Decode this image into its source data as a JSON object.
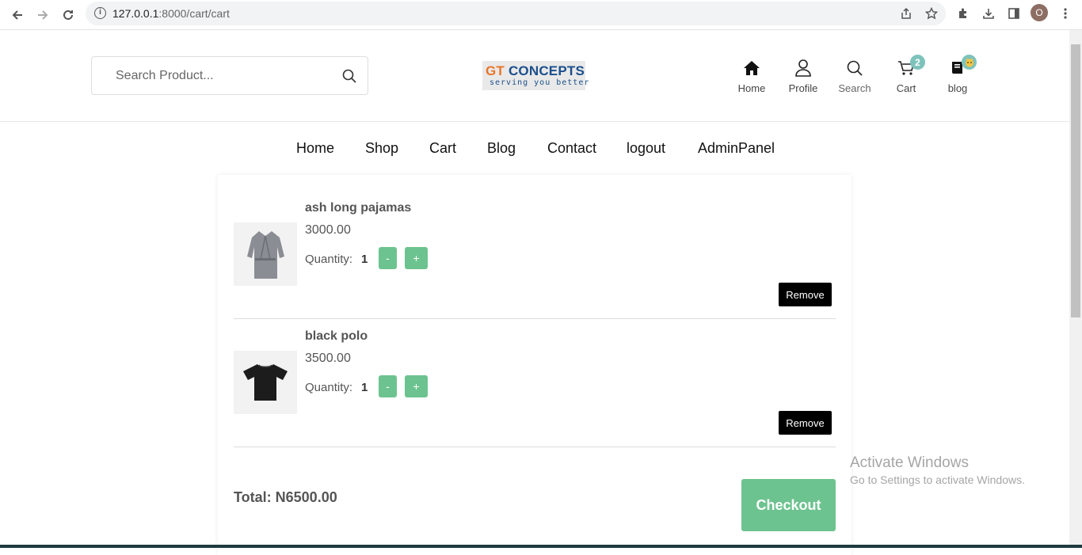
{
  "browser": {
    "url_host": "127.0.0.1",
    "url_port_path": ":8000/cart/cart",
    "profile_initial": "O"
  },
  "header": {
    "search_placeholder": "Search Product...",
    "logo": {
      "brand_gt": "GT",
      "brand_rest": " CONCEPTS",
      "tagline": "serving you better"
    },
    "icons": [
      {
        "label": "Home"
      },
      {
        "label": "Profile"
      },
      {
        "label": "Search"
      },
      {
        "label": "Cart",
        "badge": "2"
      },
      {
        "label": "blog"
      }
    ]
  },
  "menu": [
    "Home",
    "Shop",
    "Cart",
    "Blog",
    "Contact",
    "logout",
    "AdminPanel"
  ],
  "cart": {
    "items": [
      {
        "name": "ash long pajamas",
        "price": "3000.00",
        "quantity_label": "Quantity:",
        "quantity": "1",
        "minus": "-",
        "plus": "+",
        "remove": "Remove"
      },
      {
        "name": "black polo",
        "price": "3500.00",
        "quantity_label": "Quantity:",
        "quantity": "1",
        "minus": "-",
        "plus": "+",
        "remove": "Remove"
      }
    ],
    "total": "Total: N6500.00",
    "checkout": "Checkout"
  },
  "watermark": {
    "line1": "Activate Windows",
    "line2": "Go to Settings to activate Windows."
  },
  "colors": {
    "accent_green": "#6dc38f",
    "badge_teal": "#7ec3bb"
  }
}
